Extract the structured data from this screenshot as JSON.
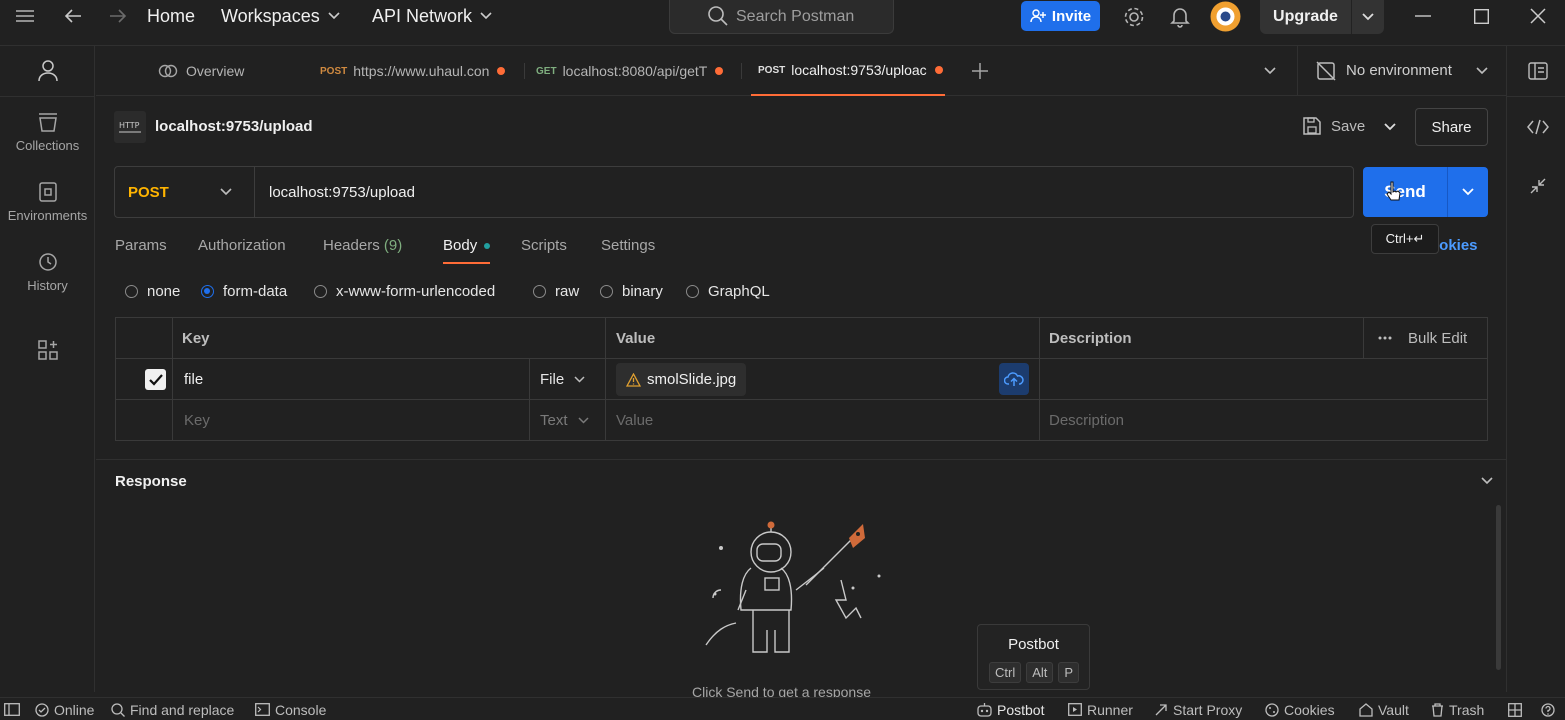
{
  "topbar": {
    "nav": [
      "Home",
      "Workspaces",
      "API Network"
    ],
    "search_placeholder": "Search Postman",
    "invite_label": "Invite",
    "upgrade_label": "Upgrade"
  },
  "left_nav": [
    {
      "label": "Collections",
      "icon": "collections-icon"
    },
    {
      "label": "Environments",
      "icon": "environments-icon"
    },
    {
      "label": "History",
      "icon": "history-icon"
    }
  ],
  "tabs": [
    {
      "label": "Overview",
      "method": "",
      "icon": "overview-icon"
    },
    {
      "label": "https://www.uhaul.con",
      "method": "POST"
    },
    {
      "label": "localhost:8080/api/getT",
      "method": "GET"
    },
    {
      "label": "localhost:9753/uploac",
      "method": "POST",
      "active": true
    }
  ],
  "environment": {
    "label": "No environment"
  },
  "request": {
    "title": "localhost:9753/upload",
    "save_label": "Save",
    "share_label": "Share",
    "method": "POST",
    "url": "localhost:9753/upload",
    "send_label": "Send",
    "send_shortcut": "Ctrl+↵",
    "cookies_label": "ookies",
    "tabs": [
      {
        "label": "Params"
      },
      {
        "label": "Authorization"
      },
      {
        "label": "Headers",
        "count": "(9)"
      },
      {
        "label": "Body",
        "active": true
      },
      {
        "label": "Scripts"
      },
      {
        "label": "Settings"
      }
    ],
    "body_types": [
      "none",
      "form-data",
      "x-www-form-urlencoded",
      "raw",
      "binary",
      "GraphQL"
    ],
    "selected_body_type": "form-data"
  },
  "form_table": {
    "headers": {
      "key": "Key",
      "value": "Value",
      "description": "Description",
      "bulk_edit": "Bulk Edit"
    },
    "rows": [
      {
        "checked": true,
        "key": "file",
        "type": "File",
        "value": "smolSlide.jpg",
        "description": ""
      }
    ],
    "new_row": {
      "key": "Key",
      "type": "Text",
      "value": "Value",
      "description": "Description"
    }
  },
  "response": {
    "title": "Response",
    "hint": "Click Send to get a response"
  },
  "postbot_popup": {
    "title": "Postbot",
    "keys": [
      "Ctrl",
      "Alt",
      "P"
    ]
  },
  "statusbar": {
    "online": "Online",
    "find_replace": "Find and replace",
    "console": "Console",
    "postbot": "Postbot",
    "runner": "Runner",
    "start_proxy": "Start Proxy",
    "cookies": "Cookies",
    "vault": "Vault",
    "trash": "Trash"
  },
  "colors": {
    "accent": "#1f6feb",
    "post_method": "#ffb400",
    "unsaved_dot": "#ff6c37",
    "bg": "#212121"
  }
}
